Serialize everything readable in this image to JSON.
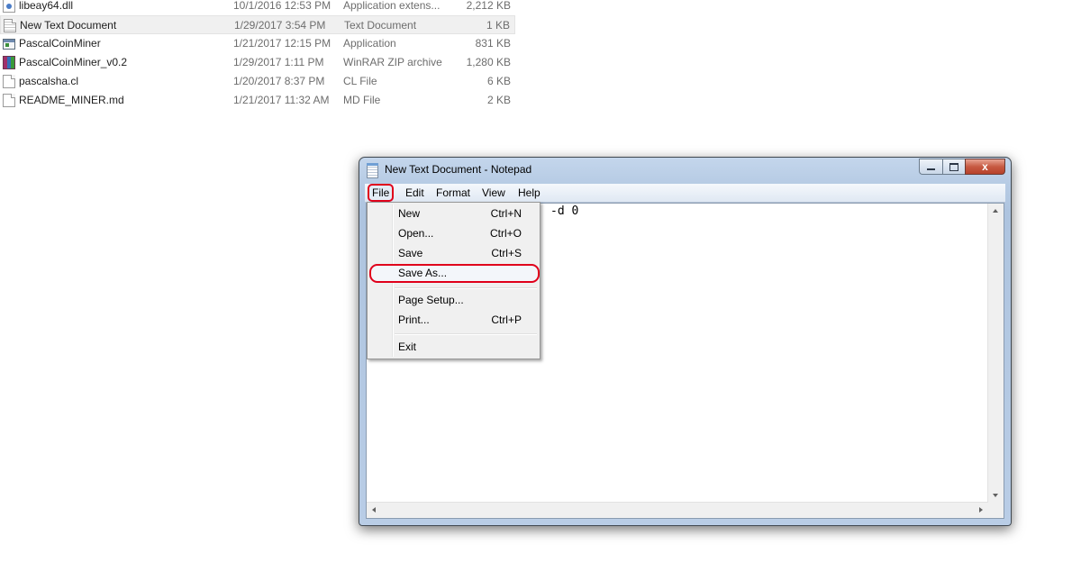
{
  "explorer": {
    "rows": [
      {
        "icon": "dll-file-icon",
        "name": "libeay64.dll",
        "date": "10/1/2016 12:53 PM",
        "type": "Application extens...",
        "size": "2,212 KB",
        "selected": false
      },
      {
        "icon": "text-file-icon",
        "name": "New Text Document",
        "date": "1/29/2017 3:54 PM",
        "type": "Text Document",
        "size": "1 KB",
        "selected": true
      },
      {
        "icon": "application-icon",
        "name": "PascalCoinMiner",
        "date": "1/21/2017 12:15 PM",
        "type": "Application",
        "size": "831 KB",
        "selected": false
      },
      {
        "icon": "winrar-archive-icon",
        "name": "PascalCoinMiner_v0.2",
        "date": "1/29/2017 1:11 PM",
        "type": "WinRAR ZIP archive",
        "size": "1,280 KB",
        "selected": false
      },
      {
        "icon": "blank-file-icon",
        "name": "pascalsha.cl",
        "date": "1/20/2017 8:37 PM",
        "type": "CL File",
        "size": "6 KB",
        "selected": false
      },
      {
        "icon": "blank-file-icon",
        "name": "README_MINER.md",
        "date": "1/21/2017 11:32 AM",
        "type": "MD File",
        "size": "2 KB",
        "selected": false
      }
    ]
  },
  "notepad": {
    "title": "New Text Document - Notepad",
    "close_glyph": "x",
    "menu": [
      "File",
      "Edit",
      "Format",
      "View",
      "Help"
    ],
    "content_visible": "-d 0",
    "file_menu": {
      "items": [
        {
          "label": "New",
          "shortcut": "Ctrl+N"
        },
        {
          "label": "Open...",
          "shortcut": "Ctrl+O"
        },
        {
          "label": "Save",
          "shortcut": "Ctrl+S"
        },
        {
          "label": "Save As...",
          "shortcut": "",
          "highlighted": true
        },
        {
          "label": "Page Setup...",
          "shortcut": ""
        },
        {
          "label": "Print...",
          "shortcut": "Ctrl+P"
        },
        {
          "label": "Exit",
          "shortcut": ""
        }
      ]
    }
  },
  "colors": {
    "highlight_ring": "#e0001b",
    "window_frame": "#b6cbe4",
    "close_button": "#c75a42"
  }
}
